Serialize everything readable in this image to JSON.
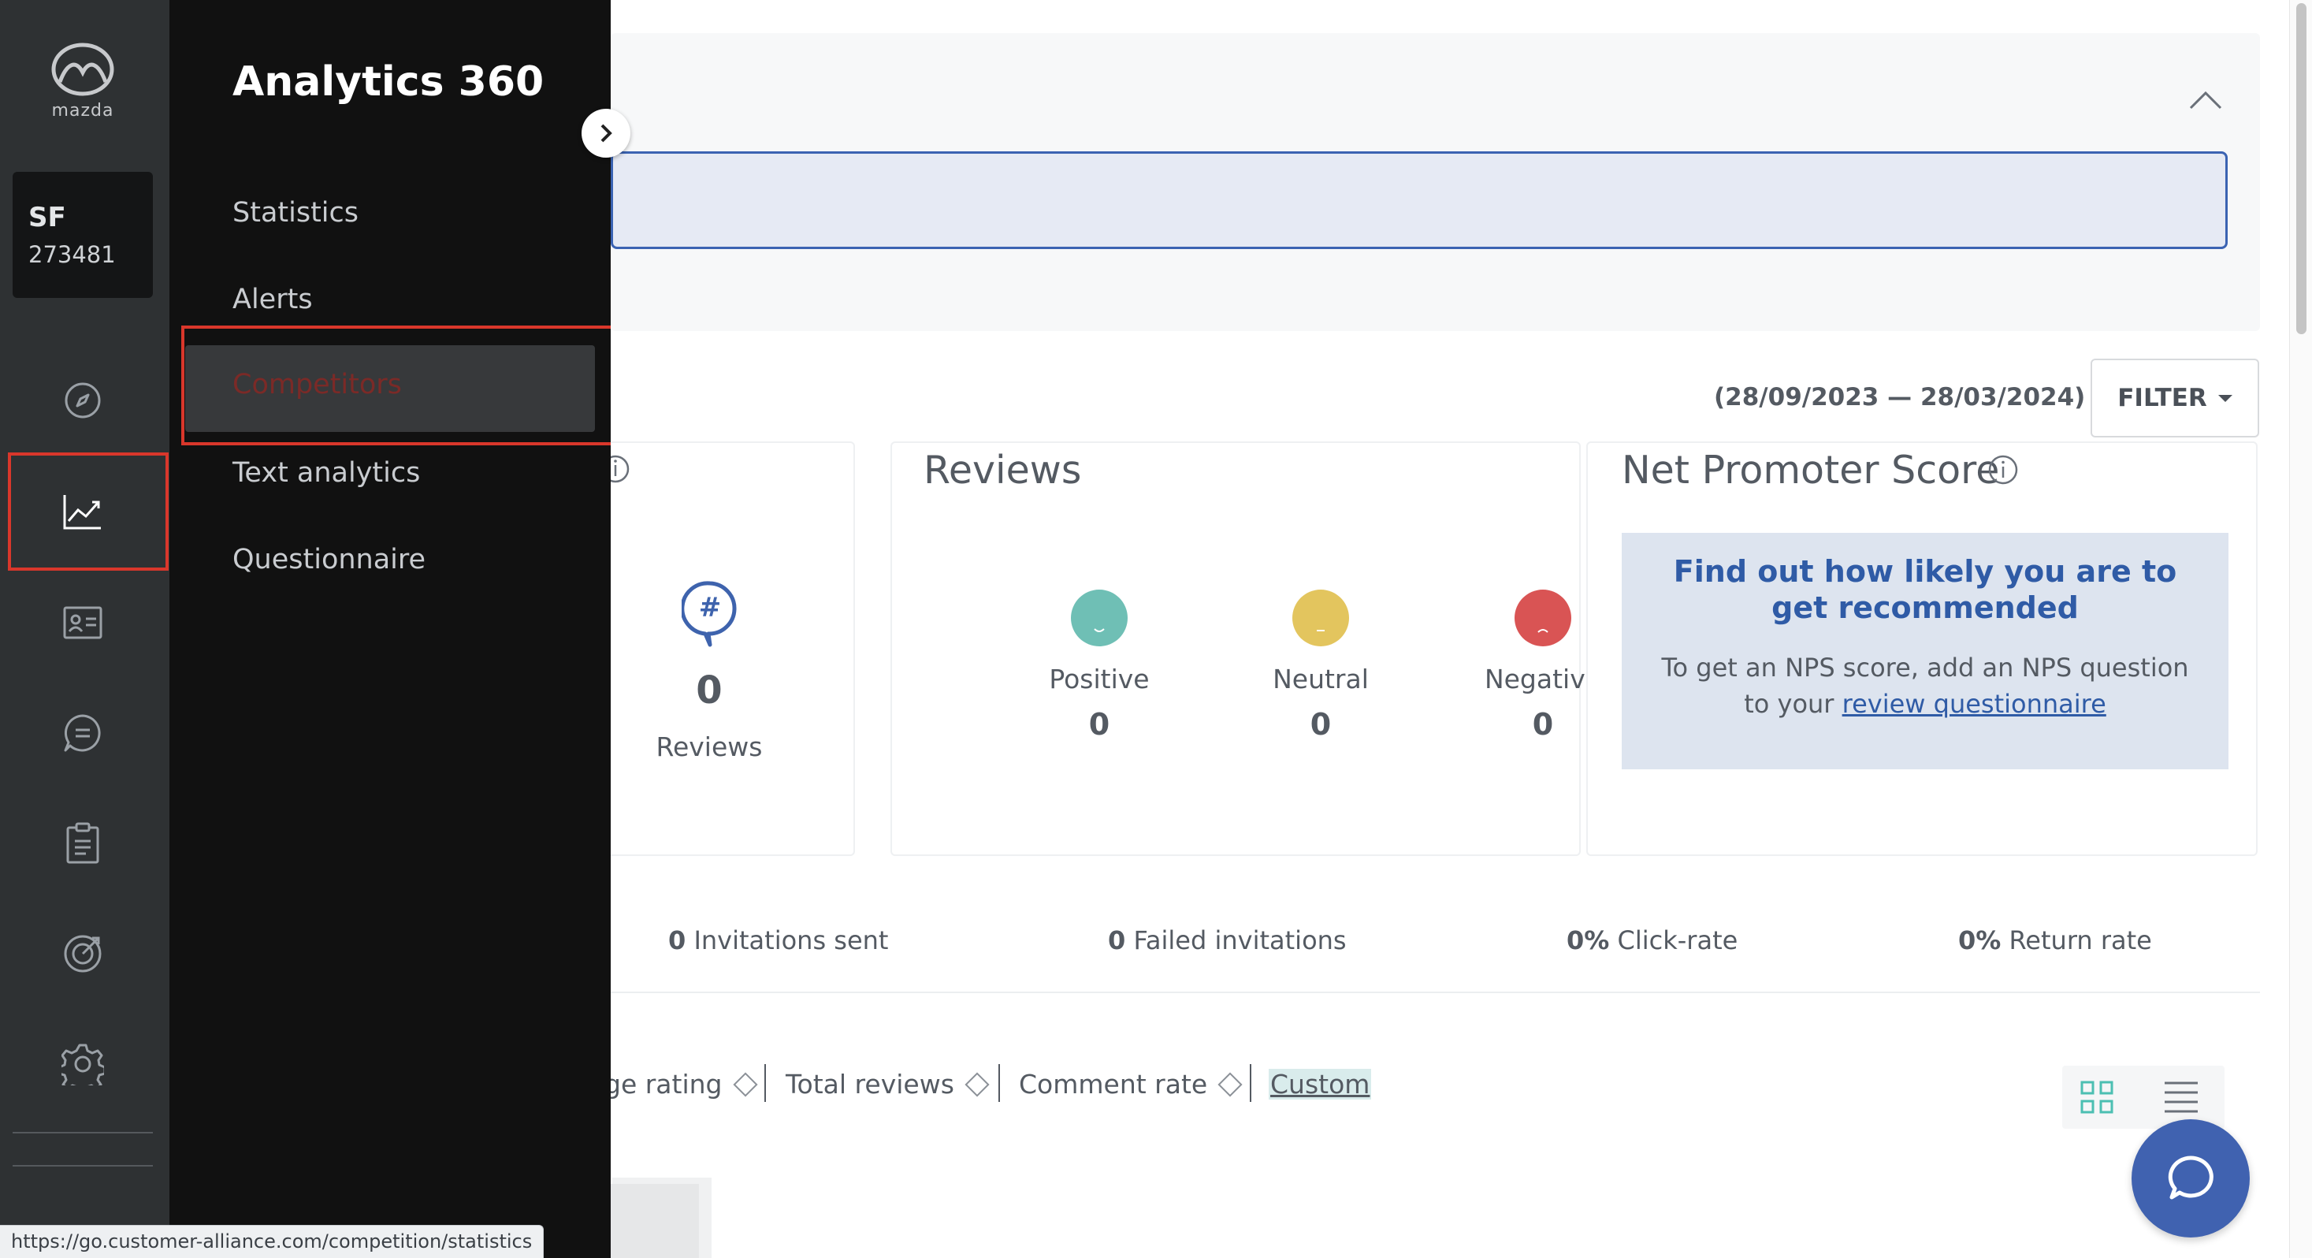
{
  "brand": {
    "logo_text": "mazda"
  },
  "account": {
    "code": "SF",
    "id": "273481"
  },
  "rail": {
    "icons": [
      "compass-icon",
      "chart-line-icon",
      "contact-card-icon",
      "chat-icon",
      "clipboard-icon",
      "target-icon",
      "gear-icon"
    ],
    "selected": "chart-line-icon"
  },
  "flyout": {
    "title": "Analytics 360",
    "items": [
      {
        "label": "Statistics"
      },
      {
        "label": "Alerts"
      },
      {
        "label": "Competitors",
        "active": true
      },
      {
        "label": "Text analytics"
      },
      {
        "label": "Questionnaire"
      }
    ]
  },
  "header": {
    "date_range": "(28/09/2023 — 28/03/2024)",
    "filter_label": "FILTER"
  },
  "total_card": {
    "count": "0",
    "label": "Reviews"
  },
  "reviews_card": {
    "title": "Reviews",
    "sentiments": [
      {
        "name": "Positive",
        "value": "0",
        "color": "#6fbfb5"
      },
      {
        "name": "Neutral",
        "value": "0",
        "color": "#e3c55e"
      },
      {
        "name": "Negative",
        "value": "0",
        "color": "#d95454"
      }
    ]
  },
  "nps_card": {
    "title": "Net Promoter Score",
    "heading": "Find out how likely you are to get recommended",
    "text_before": "To get an NPS score, add an NPS question to your",
    "link_text": "review questionnaire"
  },
  "stats": [
    {
      "value": "0",
      "label": "Invitations sent"
    },
    {
      "value": "0",
      "label": "Failed invitations"
    },
    {
      "value": "0%",
      "label": "Click-rate"
    },
    {
      "value": "0%",
      "label": "Return rate"
    }
  ],
  "sort_options": [
    {
      "label": "ge rating"
    },
    {
      "label": "Total reviews"
    },
    {
      "label": "Comment rate"
    },
    {
      "label": "Custom"
    }
  ],
  "status_bar": {
    "url": "https://go.customer-alliance.com/competition/statistics"
  },
  "colors": {
    "accent_blue": "#2f5ba6",
    "highlight_red": "#d9372b",
    "chat_blue": "#4062b0"
  }
}
